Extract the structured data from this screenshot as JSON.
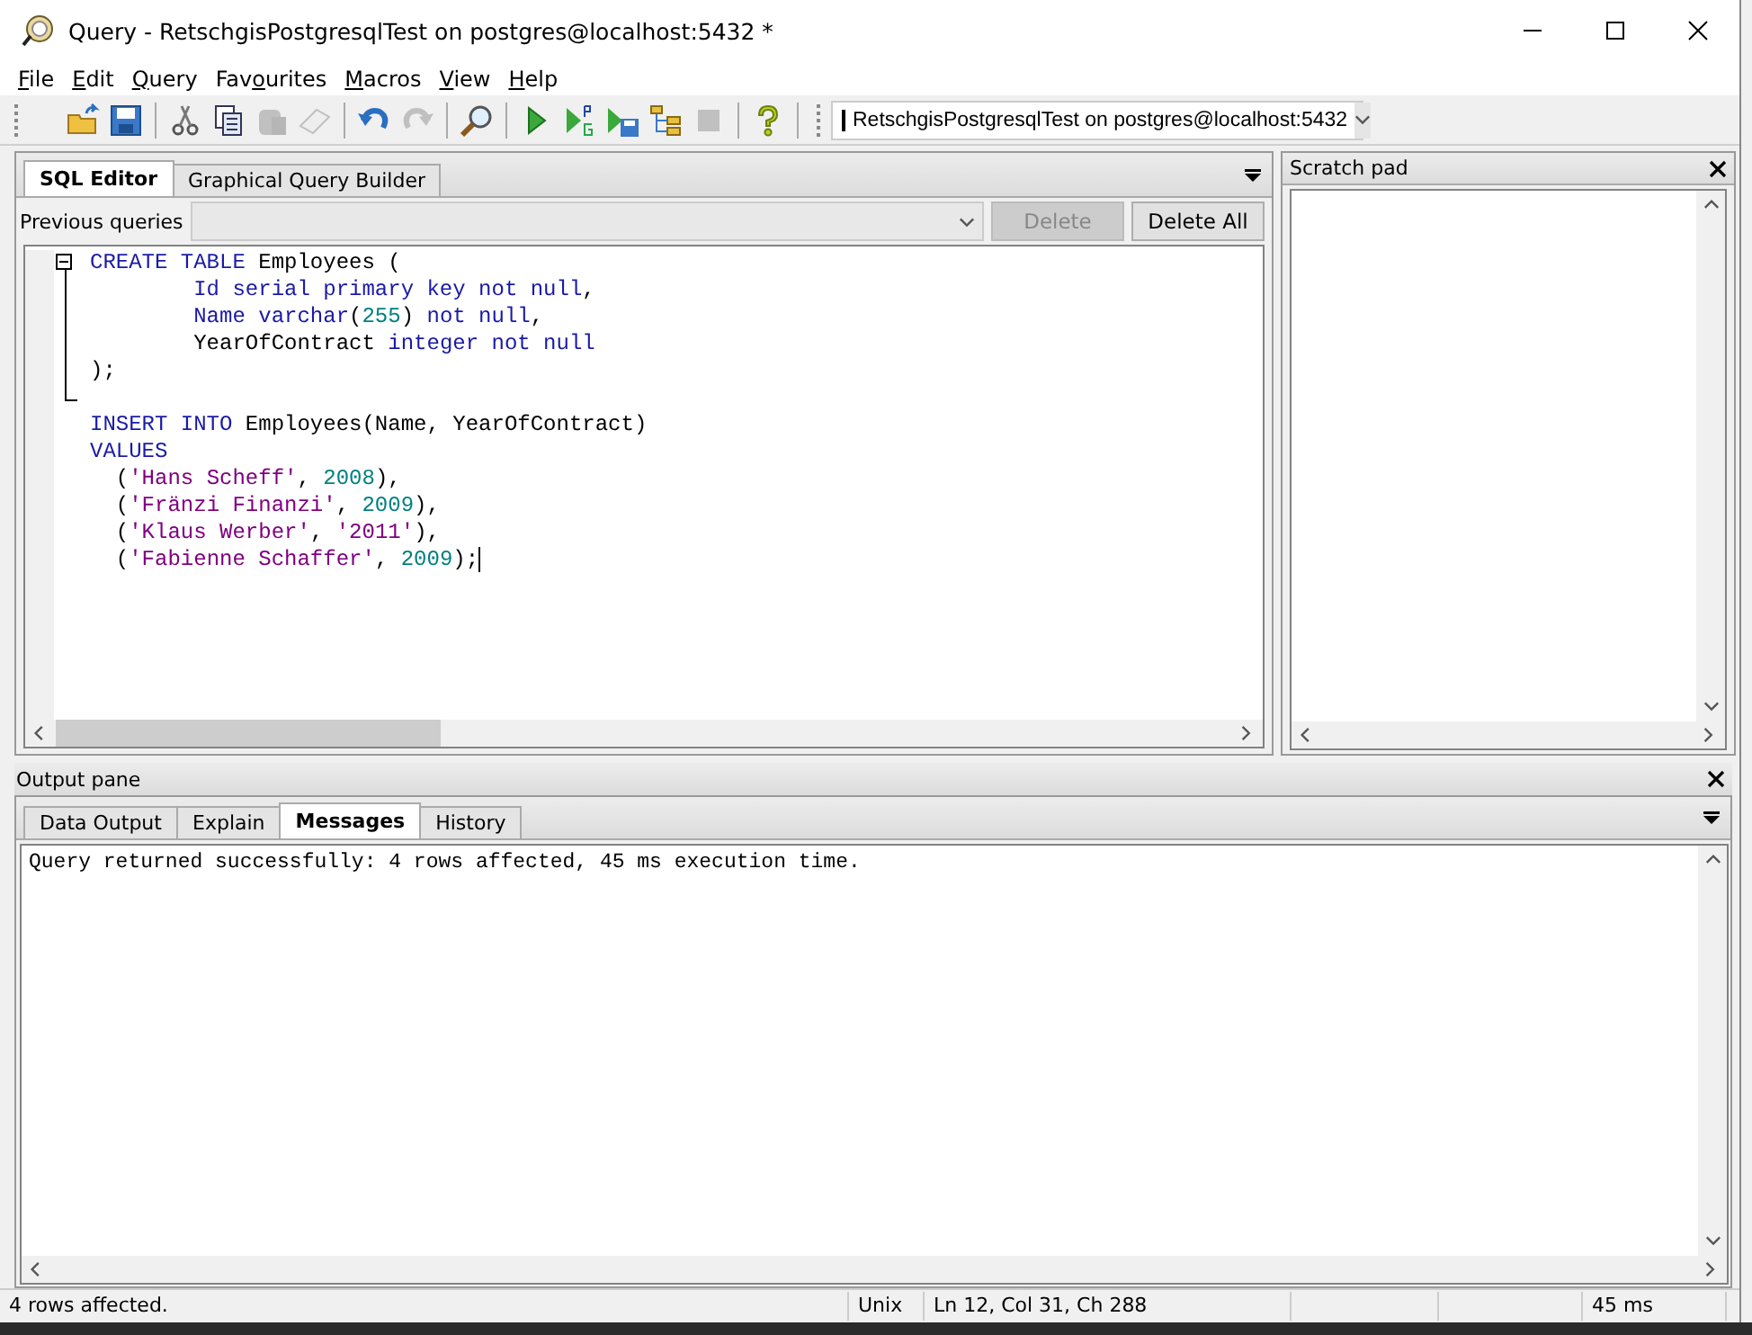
{
  "window": {
    "title": "Query - RetschgisPostgresqlTest on postgres@localhost:5432 *"
  },
  "menu": [
    {
      "key": "F",
      "rest": "ile"
    },
    {
      "key": "E",
      "rest": "dit"
    },
    {
      "key": "Q",
      "rest": "uery"
    },
    {
      "prefix": "Fav",
      "key": "o",
      "rest": "urites"
    },
    {
      "key": "M",
      "rest": "acros"
    },
    {
      "key": "V",
      "rest": "iew"
    },
    {
      "key": "H",
      "rest": "elp"
    }
  ],
  "toolbar": [
    {
      "kind": "open",
      "disabled": false
    },
    {
      "kind": "save",
      "disabled": false
    },
    {
      "kind": "sep"
    },
    {
      "kind": "cut",
      "disabled": false
    },
    {
      "kind": "copy",
      "disabled": false
    },
    {
      "kind": "paste",
      "disabled": true
    },
    {
      "kind": "eraser",
      "disabled": true
    },
    {
      "kind": "sep"
    },
    {
      "kind": "undo",
      "disabled": false
    },
    {
      "kind": "redo",
      "disabled": true
    },
    {
      "kind": "sep"
    },
    {
      "kind": "find",
      "disabled": false
    },
    {
      "kind": "sep"
    },
    {
      "kind": "run",
      "disabled": false
    },
    {
      "kind": "pgscript",
      "disabled": false
    },
    {
      "kind": "runfile",
      "disabled": false
    },
    {
      "kind": "explain",
      "disabled": false
    },
    {
      "kind": "stop",
      "disabled": true
    },
    {
      "kind": "sep"
    },
    {
      "kind": "help",
      "disabled": false
    }
  ],
  "connection": {
    "value": "RetschgisPostgresqlTest on postgres@localhost:5432"
  },
  "editor_tabs": [
    {
      "label": "SQL Editor",
      "selected": true
    },
    {
      "label": "Graphical Query Builder",
      "selected": false
    }
  ],
  "previous_queries": {
    "label": "Previous queries",
    "delete": {
      "label": "Delete",
      "disabled": true
    },
    "delete_all": {
      "label": "Delete All",
      "disabled": false
    }
  },
  "code": [
    {
      "kind": "fold-start",
      "cursor": false,
      "tokens": [
        {
          "kind": "keyword",
          "text": "CREATE TABLE "
        },
        {
          "kind": "plain",
          "text": "Employees ("
        }
      ]
    },
    {
      "kind": "fold-inside",
      "cursor": false,
      "tokens": [
        {
          "kind": "keyword",
          "text": "        Id serial primary key not null"
        },
        {
          "kind": "plain",
          "text": ","
        }
      ]
    },
    {
      "kind": "fold-inside",
      "cursor": false,
      "tokens": [
        {
          "kind": "keyword",
          "text": "        Name varchar"
        },
        {
          "kind": "plain",
          "text": "("
        },
        {
          "kind": "number",
          "text": "255"
        },
        {
          "kind": "plain",
          "text": ") "
        },
        {
          "kind": "keyword",
          "text": "not null"
        },
        {
          "kind": "plain",
          "text": ","
        }
      ]
    },
    {
      "kind": "fold-inside",
      "cursor": false,
      "tokens": [
        {
          "kind": "plain",
          "text": "        YearOfContract "
        },
        {
          "kind": "keyword",
          "text": "integer not null"
        }
      ]
    },
    {
      "kind": "fold-inside",
      "cursor": false,
      "tokens": [
        {
          "kind": "plain",
          "text": ");"
        }
      ]
    },
    {
      "kind": "fold-end"
    },
    {
      "kind": "plain",
      "cursor": false,
      "tokens": [
        {
          "kind": "keyword",
          "text": "INSERT INTO "
        },
        {
          "kind": "plain",
          "text": "Employees(Name, YearOfContract)"
        }
      ]
    },
    {
      "kind": "plain",
      "cursor": false,
      "tokens": [
        {
          "kind": "keyword",
          "text": "VALUES"
        }
      ]
    },
    {
      "kind": "plain",
      "cursor": false,
      "tokens": [
        {
          "kind": "plain",
          "text": "  ("
        },
        {
          "kind": "string",
          "text": "'Hans Scheff'"
        },
        {
          "kind": "plain",
          "text": ", "
        },
        {
          "kind": "number",
          "text": "2008"
        },
        {
          "kind": "plain",
          "text": "),"
        }
      ]
    },
    {
      "kind": "plain",
      "cursor": false,
      "tokens": [
        {
          "kind": "plain",
          "text": "  ("
        },
        {
          "kind": "string",
          "text": "'Fränzi Finanzi'"
        },
        {
          "kind": "plain",
          "text": ", "
        },
        {
          "kind": "number",
          "text": "2009"
        },
        {
          "kind": "plain",
          "text": "),"
        }
      ]
    },
    {
      "kind": "plain",
      "cursor": false,
      "tokens": [
        {
          "kind": "plain",
          "text": "  ("
        },
        {
          "kind": "string",
          "text": "'Klaus Werber'"
        },
        {
          "kind": "plain",
          "text": ", "
        },
        {
          "kind": "string",
          "text": "'2011'"
        },
        {
          "kind": "plain",
          "text": "),"
        }
      ]
    },
    {
      "kind": "plain",
      "cursor": true,
      "tokens": [
        {
          "kind": "plain",
          "text": "  ("
        },
        {
          "kind": "string",
          "text": "'Fabienne Schaffer'"
        },
        {
          "kind": "plain",
          "text": ", "
        },
        {
          "kind": "number",
          "text": "2009"
        },
        {
          "kind": "plain",
          "text": ");"
        }
      ]
    }
  ],
  "scratch_pad": {
    "title": "Scratch pad"
  },
  "output_pane": {
    "title": "Output pane",
    "tabs": [
      {
        "label": "Data Output",
        "selected": false
      },
      {
        "label": "Explain",
        "selected": false
      },
      {
        "label": "Messages",
        "selected": true
      },
      {
        "label": "History",
        "selected": false
      }
    ],
    "message": "Query returned successfully: 4 rows affected, 45 ms execution time."
  },
  "status_bar": [
    {
      "kind": "text",
      "text": "4 rows affected."
    },
    {
      "kind": "text",
      "text": "Unix"
    },
    {
      "kind": "text",
      "text": "Ln 12, Col 31, Ch 288"
    },
    {
      "kind": "empty"
    },
    {
      "kind": "empty"
    },
    {
      "kind": "text",
      "text": "45 ms"
    }
  ]
}
